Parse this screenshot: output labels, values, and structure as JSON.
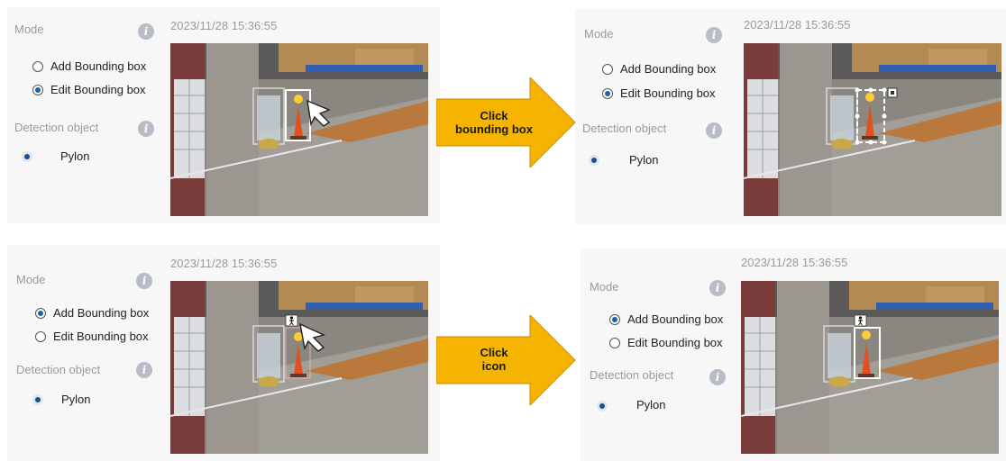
{
  "panels": [
    {
      "mode_label": "Mode",
      "timestamp": "2023/11/28 15:36:55",
      "radio_add_label": "Add Bounding box",
      "radio_edit_label": "Edit Bounding box",
      "selected_mode": "edit",
      "detection_label": "Detection object",
      "pylon_label": "Pylon"
    },
    {
      "mode_label": "Mode",
      "timestamp": "2023/11/28 15:36:55",
      "radio_add_label": "Add Bounding box",
      "radio_edit_label": "Edit Bounding box",
      "selected_mode": "edit",
      "detection_label": "Detection object",
      "pylon_label": "Pylon"
    },
    {
      "mode_label": "Mode",
      "timestamp": "2023/11/28 15:36:55",
      "radio_add_label": "Add Bounding box",
      "radio_edit_label": "Edit Bounding box",
      "selected_mode": "add",
      "detection_label": "Detection object",
      "pylon_label": "Pylon"
    },
    {
      "mode_label": "Mode",
      "timestamp": "2023/11/28 15:36:55",
      "radio_add_label": "Add Bounding box",
      "radio_edit_label": "Edit Bounding box",
      "selected_mode": "add",
      "detection_label": "Detection object",
      "pylon_label": "Pylon"
    }
  ],
  "arrows": [
    {
      "line1": "Click",
      "line2": "bounding box"
    },
    {
      "line1": "Click",
      "line2": "icon"
    }
  ],
  "colors": {
    "arrow_fill": "#f4b400",
    "radio_selected": "#1f5fa8",
    "label_gray": "#9a9a9a",
    "info_icon": "#b7bcc6",
    "pylon_orange": "#e3501f"
  },
  "icons": [
    "info-icon",
    "cursor-arrow-icon",
    "person-icon",
    "delete-handle-icon"
  ]
}
